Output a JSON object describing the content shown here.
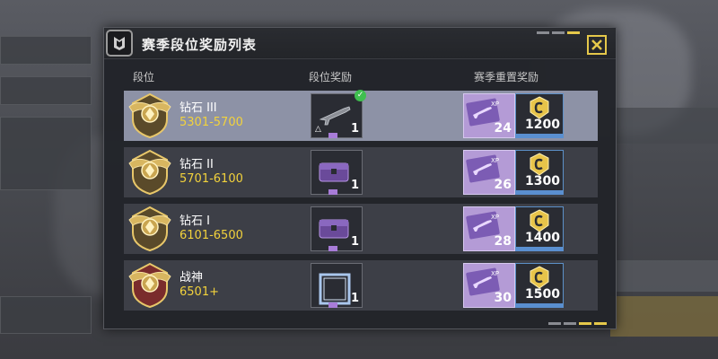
{
  "dialog": {
    "title": "赛季段位奖励列表",
    "columns": {
      "rank": "段位",
      "rank_reward": "段位奖励",
      "reset_reward": "赛季重置奖励"
    }
  },
  "rows": [
    {
      "name": "钻石 III",
      "range": "5301-5700",
      "reward_icon": "rifle-icon",
      "reward_count": "1",
      "claimed": true,
      "xp_count": "24",
      "cp_count": "1200",
      "selected": true
    },
    {
      "name": "钻石 II",
      "range": "5701-6100",
      "reward_icon": "crate-icon",
      "reward_count": "1",
      "claimed": false,
      "xp_count": "26",
      "cp_count": "1300",
      "selected": false
    },
    {
      "name": "钻石 I",
      "range": "6101-6500",
      "reward_icon": "crate-icon",
      "reward_count": "1",
      "claimed": false,
      "xp_count": "28",
      "cp_count": "1400",
      "selected": false
    },
    {
      "name": "战神",
      "range": "6501+",
      "reward_icon": "frame-icon",
      "reward_count": "1",
      "claimed": false,
      "xp_count": "30",
      "cp_count": "1500",
      "selected": false
    }
  ],
  "colors": {
    "accent": "#e5c84a",
    "range_text": "#f2d23c",
    "selected_row": "#8d92a6",
    "xp_card": "#b49bd6"
  }
}
